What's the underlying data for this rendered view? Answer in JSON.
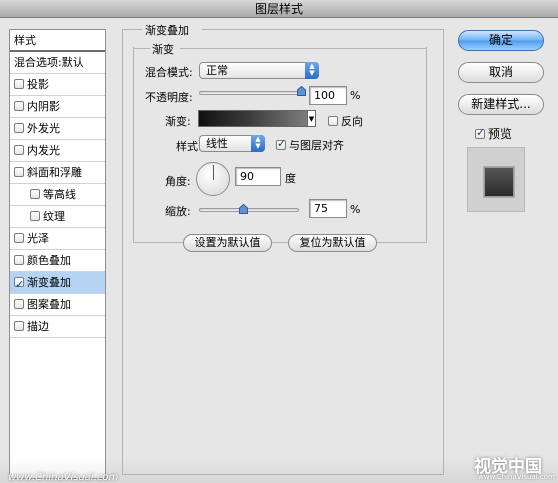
{
  "window": {
    "title": "图层样式"
  },
  "sidebar": {
    "items": [
      {
        "label": "样式",
        "type": "header",
        "checked": false
      },
      {
        "label": "混合选项:默认",
        "type": "header",
        "checked": false
      },
      {
        "label": "投影",
        "type": "check",
        "checked": false
      },
      {
        "label": "内阴影",
        "type": "check",
        "checked": false
      },
      {
        "label": "外发光",
        "type": "check",
        "checked": false
      },
      {
        "label": "内发光",
        "type": "check",
        "checked": false
      },
      {
        "label": "斜面和浮雕",
        "type": "check",
        "checked": false
      },
      {
        "label": "等高线",
        "type": "sub",
        "checked": false
      },
      {
        "label": "纹理",
        "type": "sub",
        "checked": false
      },
      {
        "label": "光泽",
        "type": "check",
        "checked": false
      },
      {
        "label": "颜色叠加",
        "type": "check",
        "checked": false
      },
      {
        "label": "渐变叠加",
        "type": "check",
        "checked": true,
        "selected": true
      },
      {
        "label": "图案叠加",
        "type": "check",
        "checked": false
      },
      {
        "label": "描边",
        "type": "check",
        "checked": false
      }
    ]
  },
  "panel": {
    "title": "渐变叠加",
    "group_title": "渐变",
    "blend_mode": {
      "label": "混合模式:",
      "value": "正常"
    },
    "opacity": {
      "label": "不透明度:",
      "value": "100",
      "unit": "%",
      "level": 100
    },
    "gradient": {
      "label": "渐变:",
      "reverse_label": "反向",
      "reverse_checked": false
    },
    "style": {
      "label": "样式:",
      "value": "线性",
      "align_label": "与图层对齐",
      "align_checked": true
    },
    "angle": {
      "label": "角度:",
      "value": "90",
      "unit": "度"
    },
    "scale": {
      "label": "缩放:",
      "value": "75",
      "unit": "%",
      "level": 75
    },
    "make_default_label": "设置为默认值",
    "reset_default_label": "复位为默认值"
  },
  "actions": {
    "ok_label": "确定",
    "cancel_label": "取消",
    "new_style_label": "新建样式...",
    "preview_label": "预览",
    "preview_checked": true
  },
  "watermark": {
    "left": "www.ChinaVisual.com",
    "right": "视觉中国",
    "right_sub": "www.ChinaVisual.com"
  },
  "colors": {
    "accent": "#4d9bef",
    "selection": "#b5d3f2"
  }
}
